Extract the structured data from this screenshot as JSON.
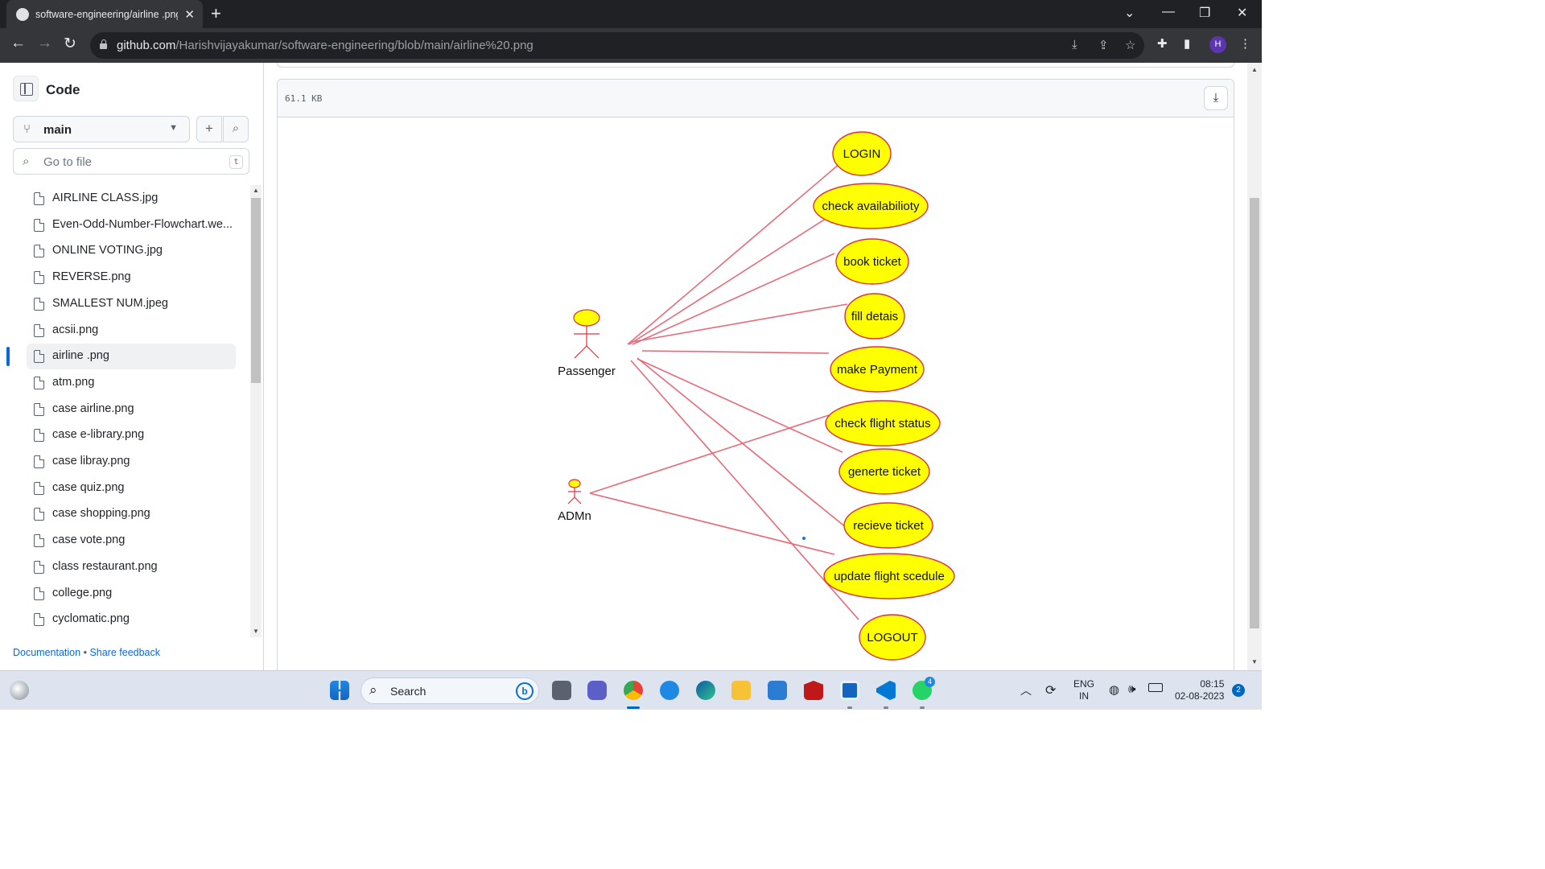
{
  "browser": {
    "tab_title": "software-engineering/airline .png",
    "url_host": "github.com",
    "url_path": "/Harishvijayakumar/software-engineering/blob/main/airline%20.png",
    "profile_initial": "H"
  },
  "sidebar": {
    "title": "Code",
    "branch": "main",
    "search_placeholder": "Go to file",
    "search_key": "t",
    "files": [
      {
        "label": "AIRLINE CLASS.jpg"
      },
      {
        "label": "Even-Odd-Number-Flowchart.we..."
      },
      {
        "label": "ONLINE VOTING.jpg"
      },
      {
        "label": "REVERSE.png"
      },
      {
        "label": "SMALLEST NUM.jpeg"
      },
      {
        "label": "acsii.png"
      },
      {
        "label": "airline .png",
        "active": true
      },
      {
        "label": "atm.png"
      },
      {
        "label": "case airline.png"
      },
      {
        "label": "case e-library.png"
      },
      {
        "label": "case libray.png"
      },
      {
        "label": "case quiz.png"
      },
      {
        "label": "case shopping.png"
      },
      {
        "label": "case vote.png"
      },
      {
        "label": "class restaurant.png"
      },
      {
        "label": "college.png"
      },
      {
        "label": "cyclomatic.png"
      }
    ],
    "footer": {
      "doc": "Documentation",
      "sep": "•",
      "feedback": "Share feedback"
    }
  },
  "viewer": {
    "file_size": "61.1 KB"
  },
  "diagram": {
    "actors": [
      {
        "id": "passenger",
        "label": "Passenger"
      },
      {
        "id": "admin",
        "label": "ADMn"
      }
    ],
    "use_cases": [
      {
        "id": "login",
        "label": "LOGIN"
      },
      {
        "id": "check_avail",
        "label": "check availabilioty"
      },
      {
        "id": "book",
        "label": "book ticket"
      },
      {
        "id": "fill",
        "label": "fill detais"
      },
      {
        "id": "payment",
        "label": "make Payment"
      },
      {
        "id": "status",
        "label": "check flight status"
      },
      {
        "id": "generate",
        "label": "generte ticket"
      },
      {
        "id": "receive",
        "label": "recieve ticket"
      },
      {
        "id": "update",
        "label": "update flight scedule"
      },
      {
        "id": "logout",
        "label": "LOGOUT"
      }
    ],
    "colors": {
      "use_case_fill": "#ffff00",
      "use_case_stroke": "#e0303c",
      "line": "#e86a7a",
      "actor_fill": "#ffff00"
    }
  },
  "taskbar": {
    "search_label": "Search",
    "lang_top": "ENG",
    "lang_bottom": "IN",
    "time": "08:15",
    "date": "02-08-2023",
    "notification_count": "2",
    "whatsapp_badge": "4"
  }
}
